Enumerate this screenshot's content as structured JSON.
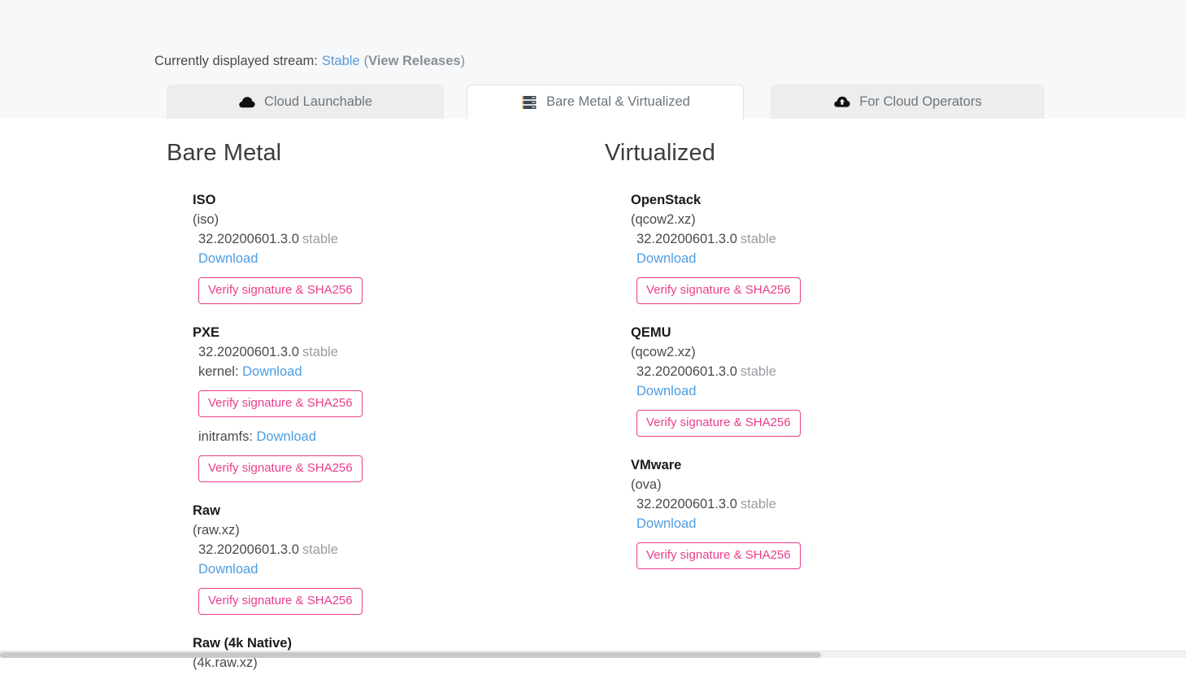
{
  "stream_bar": {
    "label": "Currently displayed stream:",
    "value": "Stable",
    "paren_open": "(",
    "releases_link": "View Releases",
    "paren_close": ")"
  },
  "tabs": [
    {
      "id": "cloud-launchable",
      "label": "Cloud Launchable",
      "icon": "cloud-icon",
      "active": false
    },
    {
      "id": "bare-metal-virtualized",
      "label": "Bare Metal & Virtualized",
      "icon": "server-icon",
      "active": true
    },
    {
      "id": "for-cloud-operators",
      "label": "For Cloud Operators",
      "icon": "cloud-upload-icon",
      "active": false
    }
  ],
  "columns": {
    "bare_metal": {
      "title": "Bare Metal",
      "artifacts": [
        {
          "name": "ISO",
          "format": "(iso)",
          "version": "32.20200601.3.0",
          "stream": "stable",
          "downloads": [
            {
              "prefix": "",
              "label": "Download",
              "verify": "Verify signature & SHA256"
            }
          ]
        },
        {
          "name": "PXE",
          "format": "",
          "version": "32.20200601.3.0",
          "stream": "stable",
          "downloads": [
            {
              "prefix": "kernel: ",
              "label": "Download",
              "verify": "Verify signature & SHA256"
            },
            {
              "prefix": "initramfs: ",
              "label": "Download",
              "verify": "Verify signature & SHA256"
            }
          ]
        },
        {
          "name": "Raw",
          "format": "(raw.xz)",
          "version": "32.20200601.3.0",
          "stream": "stable",
          "downloads": [
            {
              "prefix": "",
              "label": "Download",
              "verify": "Verify signature & SHA256"
            }
          ]
        },
        {
          "name": "Raw (4k Native)",
          "format": "(4k.raw.xz)",
          "version": "",
          "stream": "",
          "downloads": []
        }
      ]
    },
    "virtualized": {
      "title": "Virtualized",
      "artifacts": [
        {
          "name": "OpenStack",
          "format": "(qcow2.xz)",
          "version": "32.20200601.3.0",
          "stream": "stable",
          "downloads": [
            {
              "prefix": "",
              "label": "Download",
              "verify": "Verify signature & SHA256"
            }
          ]
        },
        {
          "name": "QEMU",
          "format": "(qcow2.xz)",
          "version": "32.20200601.3.0",
          "stream": "stable",
          "downloads": [
            {
              "prefix": "",
              "label": "Download",
              "verify": "Verify signature & SHA256"
            }
          ]
        },
        {
          "name": "VMware",
          "format": "(ova)",
          "version": "32.20200601.3.0",
          "stream": "stable",
          "downloads": [
            {
              "prefix": "",
              "label": "Download",
              "verify": "Verify signature & SHA256"
            }
          ]
        }
      ]
    }
  },
  "colors": {
    "link": "#4d9de0",
    "verify_accent": "#e83e8c",
    "muted": "#999da1",
    "tab_inactive_bg": "#ededed",
    "page_top_bg": "#f6f8fa"
  }
}
